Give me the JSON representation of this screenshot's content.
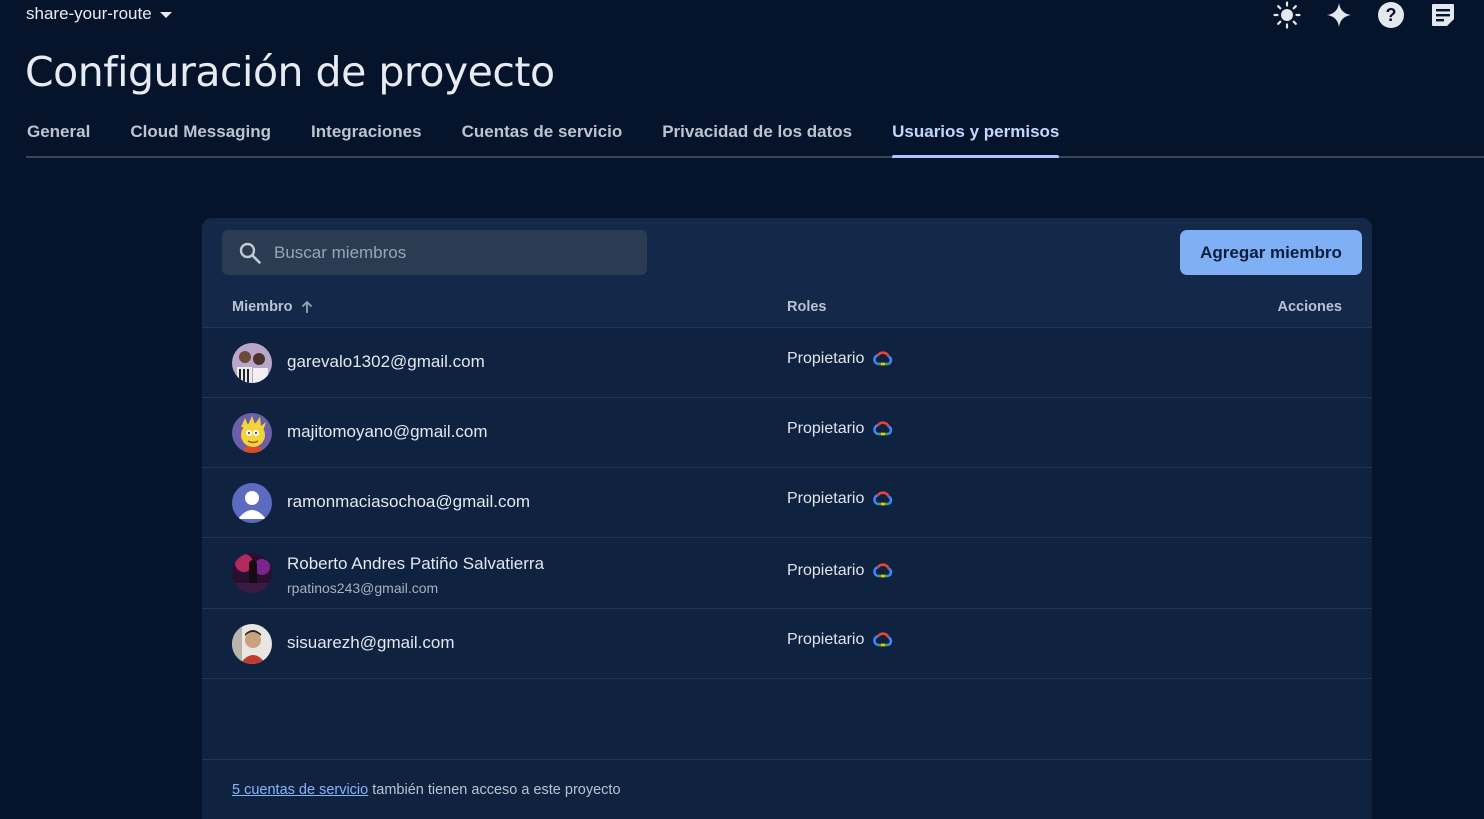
{
  "header": {
    "project_name": "share-your-route",
    "icons": [
      "theme-brightness-icon",
      "gemini-sparkle-icon",
      "help-icon",
      "notes-icon"
    ]
  },
  "page": {
    "title": "Configuración de proyecto"
  },
  "tabs": [
    {
      "label": "General",
      "active": false
    },
    {
      "label": "Cloud Messaging",
      "active": false
    },
    {
      "label": "Integraciones",
      "active": false
    },
    {
      "label": "Cuentas de servicio",
      "active": false
    },
    {
      "label": "Privacidad de los datos",
      "active": false
    },
    {
      "label": "Usuarios y permisos",
      "active": true
    }
  ],
  "search": {
    "placeholder": "Buscar miembros",
    "value": ""
  },
  "toolbar": {
    "add_member_label": "Agregar miembro"
  },
  "table": {
    "columns": {
      "member": "Miembro",
      "roles": "Roles",
      "actions": "Acciones"
    },
    "sort": "member-ascending",
    "rows": [
      {
        "name": "",
        "email": "garevalo1302@gmail.com",
        "role": "Propietario"
      },
      {
        "name": "",
        "email": "majitomoyano@gmail.com",
        "role": "Propietario"
      },
      {
        "name": "",
        "email": "ramonmaciasochoa@gmail.com",
        "role": "Propietario"
      },
      {
        "name": "Roberto Andres Patiño Salvatierra",
        "email": "rpatinos243@gmail.com",
        "role": "Propietario"
      },
      {
        "name": "",
        "email": "sisuarezh@gmail.com",
        "role": "Propietario"
      }
    ]
  },
  "footer": {
    "link_text": "5 cuentas de servicio",
    "text": " también tienen acceso a este proyecto"
  },
  "colors": {
    "background": "#06142b",
    "panel": "#0f2340",
    "accent": "#7fb0f5",
    "active_tab": "#a9c7ff"
  }
}
